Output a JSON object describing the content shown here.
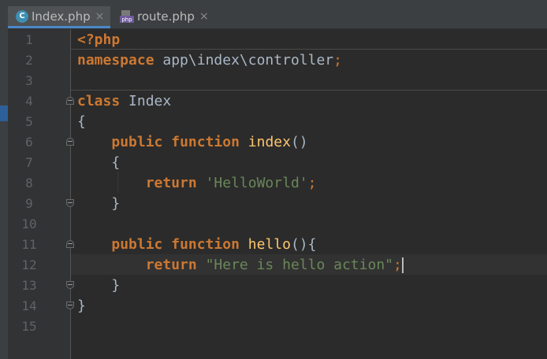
{
  "tabs": [
    {
      "label": "Index.php",
      "close": "×",
      "icon": "php-class-icon",
      "active": true
    },
    {
      "label": "route.php",
      "close": "×",
      "icon": "php-file-icon",
      "active": false
    }
  ],
  "line_numbers": [
    "1",
    "2",
    "3",
    "4",
    "5",
    "6",
    "7",
    "8",
    "9",
    "10",
    "11",
    "12",
    "13",
    "14",
    "15"
  ],
  "code": {
    "l1": {
      "k": "<?php"
    },
    "l2": {
      "k": "namespace",
      "t": " app\\index\\controller",
      "s": ";"
    },
    "l4": {
      "k": "class",
      "t": " Index"
    },
    "l5": {
      "t": "{"
    },
    "l6": {
      "k1": "public",
      "k2": "function",
      "fn": "index",
      "t": "()"
    },
    "l7": {
      "t": "{"
    },
    "l8": {
      "k": "return",
      "str": "'HelloWorld'",
      "s": ";"
    },
    "l9": {
      "t": "}"
    },
    "l11": {
      "k1": "public",
      "k2": "function",
      "fn": "hello",
      "t": "(){"
    },
    "l12": {
      "k": "return",
      "str": "\"Here is hello action\"",
      "s": ";"
    },
    "l13": {
      "t": "}"
    },
    "l14": {
      "t": "}"
    }
  },
  "colors": {
    "keyword": "#cc7832",
    "string": "#6a8759",
    "text": "#a9b7c6",
    "function": "#ffc66d"
  }
}
